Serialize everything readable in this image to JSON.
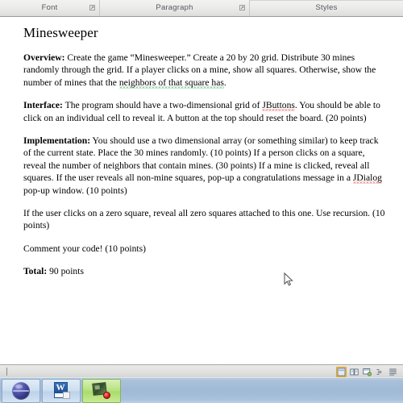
{
  "ribbon": {
    "groups": [
      {
        "label": "Font",
        "has_dialog_launcher": true,
        "launcher_icon": "dialog-launcher-icon"
      },
      {
        "label": "Paragraph",
        "has_dialog_launcher": true,
        "launcher_icon": "dialog-launcher-icon"
      },
      {
        "label": "Styles",
        "has_dialog_launcher": false,
        "launcher_icon": ""
      }
    ]
  },
  "document": {
    "title": "Minesweeper",
    "paragraphs": [
      {
        "id": "overview",
        "lead": "Overview:",
        "runs": [
          {
            "text": "  Create the game “Minesweeper.” Create a 20 by 20 grid.  Distribute 30 mines randomly through the grid.  If a player clicks on a mine, show all squares.  Otherwise, show the number of mines that the ",
            "mark": "none"
          },
          {
            "text": "neighbors of that square has",
            "mark": "grammar"
          },
          {
            "text": ".",
            "mark": "none"
          }
        ]
      },
      {
        "id": "interface",
        "lead": "Interface:",
        "runs": [
          {
            "text": "  The program should have a two-dimensional grid of ",
            "mark": "none"
          },
          {
            "text": "JButtons",
            "mark": "spelling"
          },
          {
            "text": ".  You should be able to click on an individual cell to reveal it.  A button at the top should reset the board.  (20 points)",
            "mark": "none"
          }
        ]
      },
      {
        "id": "implementation",
        "lead": "Implementation:",
        "runs": [
          {
            "text": "  You should use a two dimensional array (or something similar) to keep track of the current state.  Place the 30 mines randomly.  (10 points)  If a person clicks on a square, reveal the number of neighbors that contain mines.  (30 points)  If a mine is clicked, reveal all squares.  If the user reveals all non-mine squares, pop-up a congratulations message in a ",
            "mark": "none"
          },
          {
            "text": "JDialog",
            "mark": "spelling"
          },
          {
            "text": " pop-up window. (10 points)",
            "mark": "none"
          }
        ]
      },
      {
        "id": "recursion",
        "lead": "",
        "runs": [
          {
            "text": "If the user clicks on a zero square, reveal all zero squares attached to this one.  Use recursion.  (10 points)",
            "mark": "none"
          }
        ]
      },
      {
        "id": "comment",
        "lead": "",
        "runs": [
          {
            "text": "Comment your code! (10 points)",
            "mark": "none"
          }
        ]
      },
      {
        "id": "total",
        "lead": "Total:",
        "runs": [
          {
            "text": " 90 points",
            "mark": "none"
          }
        ]
      }
    ]
  },
  "status_bar": {
    "view_buttons": [
      {
        "name": "print-layout-view",
        "icon": "print-layout-icon",
        "active": true
      },
      {
        "name": "full-screen-reading-view",
        "icon": "full-screen-reading-icon",
        "active": false
      },
      {
        "name": "web-layout-view",
        "icon": "web-layout-icon",
        "active": false
      },
      {
        "name": "outline-view",
        "icon": "outline-icon",
        "active": false
      },
      {
        "name": "draft-view",
        "icon": "draft-icon",
        "active": false
      }
    ]
  },
  "taskbar": {
    "items": [
      {
        "name": "start-orb",
        "icon": "start-orb-icon",
        "label": "",
        "active": false
      },
      {
        "name": "microsoft-word-task",
        "icon": "word-document-icon",
        "label": "W",
        "active": false
      },
      {
        "name": "screen-recorder-task",
        "icon": "screen-recorder-icon",
        "label": "",
        "active": true
      }
    ]
  },
  "colors": {
    "ribbon_bg": "#ececeb",
    "page_bg": "#ffffff",
    "status_bg": "#e2e2e0",
    "taskbar_bg": "#9fb9d6",
    "spelling_underline": "#e03030",
    "grammar_underline": "#2e9e4e",
    "view_active_border": "#e8a317",
    "task_active_bg": "#a9dc6b"
  }
}
